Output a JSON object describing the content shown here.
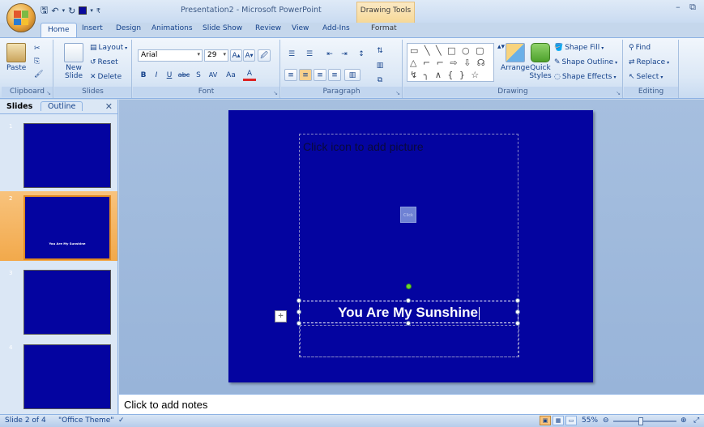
{
  "window": {
    "title": "Presentation2 - Microsoft PowerPoint",
    "contextual_tab_group": "Drawing Tools",
    "controls": "– ⧉"
  },
  "tabs": [
    "Home",
    "Insert",
    "Design",
    "Animations",
    "Slide Show",
    "Review",
    "View",
    "Add-Ins",
    "Format"
  ],
  "active_tab": "Home",
  "ribbon": {
    "clipboard": {
      "label": "Clipboard",
      "paste": "Paste"
    },
    "slides": {
      "label": "Slides",
      "new_slide": "New Slide",
      "layout": "Layout",
      "reset": "Reset",
      "delete": "Delete"
    },
    "font": {
      "label": "Font",
      "font_name": "Arial",
      "font_size": "29",
      "bold": "B",
      "italic": "I",
      "underline": "U",
      "strike": "abc",
      "shadow": "S",
      "spacing": "AV",
      "case": "Aa",
      "color": "A"
    },
    "paragraph": {
      "label": "Paragraph"
    },
    "drawing": {
      "label": "Drawing",
      "arrange": "Arrange",
      "quick_styles": "Quick Styles",
      "shape_fill": "Shape Fill",
      "shape_outline": "Shape Outline",
      "shape_effects": "Shape Effects"
    },
    "editing": {
      "label": "Editing",
      "find": "Find",
      "replace": "Replace",
      "select": "Select"
    }
  },
  "slide_pane": {
    "tab_slides": "Slides",
    "tab_outline": "Outline",
    "thumbnails": [
      {
        "num": "1",
        "text": ""
      },
      {
        "num": "2",
        "text": "You Are My Sunshine"
      },
      {
        "num": "3",
        "text": ""
      },
      {
        "num": "4",
        "text": ""
      }
    ],
    "selected_index": 1
  },
  "slide": {
    "picture_placeholder": "Click icon to add picture",
    "title": "You Are My Sunshine",
    "background_color": "#0404a0"
  },
  "notes": {
    "placeholder": "Click to add notes"
  },
  "statusbar": {
    "slide_info": "Slide 2 of 4",
    "theme": "\"Office Theme\"",
    "zoom": "55%"
  }
}
